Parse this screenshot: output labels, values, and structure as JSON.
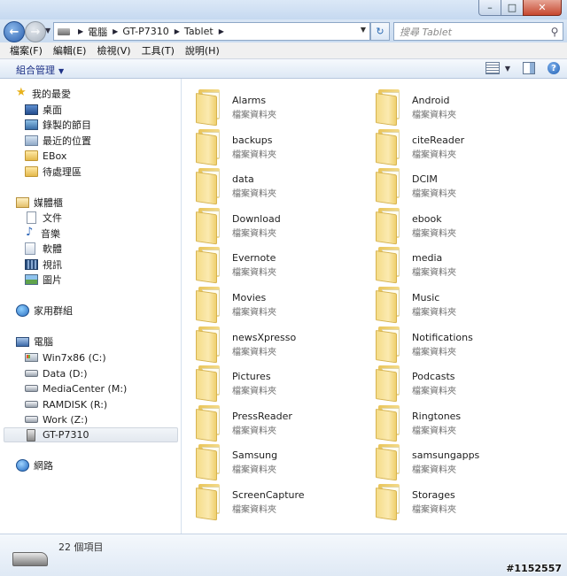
{
  "address": {
    "crumbs": [
      "電腦",
      "GT-P7310",
      "Tablet"
    ],
    "search_placeholder": "搜尋 Tablet"
  },
  "menu": [
    "檔案(F)",
    "編輯(E)",
    "檢視(V)",
    "工具(T)",
    "說明(H)"
  ],
  "toolbar": {
    "organize": "組合管理"
  },
  "nav": {
    "favorites": {
      "label": "我的最愛",
      "items": [
        "桌面",
        "錄製的節目",
        "最近的位置",
        "EBox",
        "待處理區"
      ]
    },
    "libraries": {
      "label": "媒體櫃",
      "items": [
        "文件",
        "音樂",
        "軟體",
        "視訊",
        "圖片"
      ]
    },
    "homegroup": "家用群組",
    "computer": {
      "label": "電腦",
      "items": [
        "Win7x86 (C:)",
        "Data (D:)",
        "MediaCenter (M:)",
        "RAMDISK (R:)",
        "Work (Z:)",
        "GT-P7310"
      ]
    },
    "network": "網路"
  },
  "folders": [
    {
      "name": "Alarms",
      "type": "檔案資料夾"
    },
    {
      "name": "Android",
      "type": "檔案資料夾"
    },
    {
      "name": "backups",
      "type": "檔案資料夾"
    },
    {
      "name": "citeReader",
      "type": "檔案資料夾"
    },
    {
      "name": "data",
      "type": "檔案資料夾"
    },
    {
      "name": "DCIM",
      "type": "檔案資料夾"
    },
    {
      "name": "Download",
      "type": "檔案資料夾"
    },
    {
      "name": "ebook",
      "type": "檔案資料夾"
    },
    {
      "name": "Evernote",
      "type": "檔案資料夾"
    },
    {
      "name": "media",
      "type": "檔案資料夾"
    },
    {
      "name": "Movies",
      "type": "檔案資料夾"
    },
    {
      "name": "Music",
      "type": "檔案資料夾"
    },
    {
      "name": "newsXpresso",
      "type": "檔案資料夾"
    },
    {
      "name": "Notifications",
      "type": "檔案資料夾"
    },
    {
      "name": "Pictures",
      "type": "檔案資料夾"
    },
    {
      "name": "Podcasts",
      "type": "檔案資料夾"
    },
    {
      "name": "PressReader",
      "type": "檔案資料夾"
    },
    {
      "name": "Ringtones",
      "type": "檔案資料夾"
    },
    {
      "name": "Samsung",
      "type": "檔案資料夾"
    },
    {
      "name": "samsungapps",
      "type": "檔案資料夾"
    },
    {
      "name": "ScreenCapture",
      "type": "檔案資料夾"
    },
    {
      "name": "Storages",
      "type": "檔案資料夾"
    }
  ],
  "status": {
    "item_count": "22 個項目"
  },
  "watermark": "#1152557"
}
